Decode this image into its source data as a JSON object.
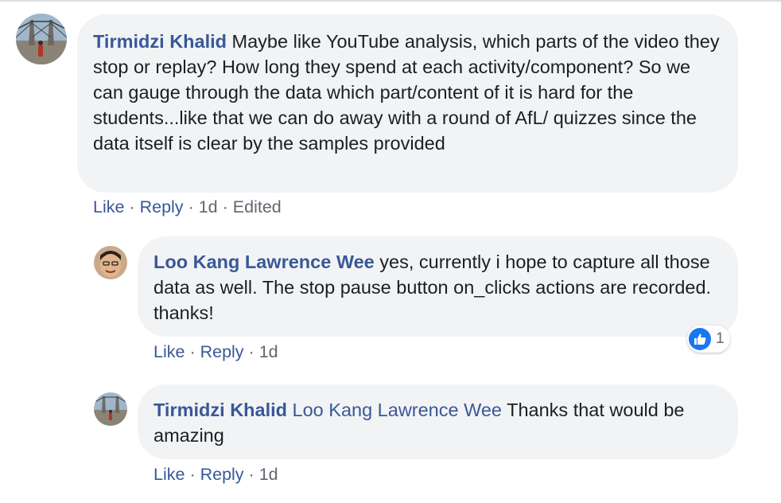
{
  "comments": [
    {
      "author": "Tirmidzi Khalid",
      "text": "Maybe like YouTube analysis, which parts of the video they stop or replay? How long they spend at each activity/component? So we can gauge through the data which part/content of it is hard for the students...like that we can do away with a round of AfL/ quizzes since the data itself is clear by the samples provided",
      "actions": {
        "like": "Like",
        "reply": "Reply",
        "time": "1d",
        "edited": "Edited"
      },
      "replies": [
        {
          "author": "Loo Kang Lawrence Wee",
          "text": "yes, currently i hope to capture all those data as well. The stop pause button on_clicks actions are recorded. thanks!",
          "actions": {
            "like": "Like",
            "reply": "Reply",
            "time": "1d"
          },
          "reactions": {
            "icon": "thumbs-up-icon",
            "count": "1"
          }
        },
        {
          "author": "Tirmidzi Khalid",
          "mention": "Loo Kang Lawrence Wee",
          "text": "Thanks that would be amazing",
          "actions": {
            "like": "Like",
            "reply": "Reply",
            "time": "1d"
          }
        }
      ]
    }
  ],
  "separator": "·",
  "colors": {
    "link": "#385898",
    "bubble": "#f2f3f5",
    "meta": "#606770",
    "like_blue": "#1877f2"
  }
}
